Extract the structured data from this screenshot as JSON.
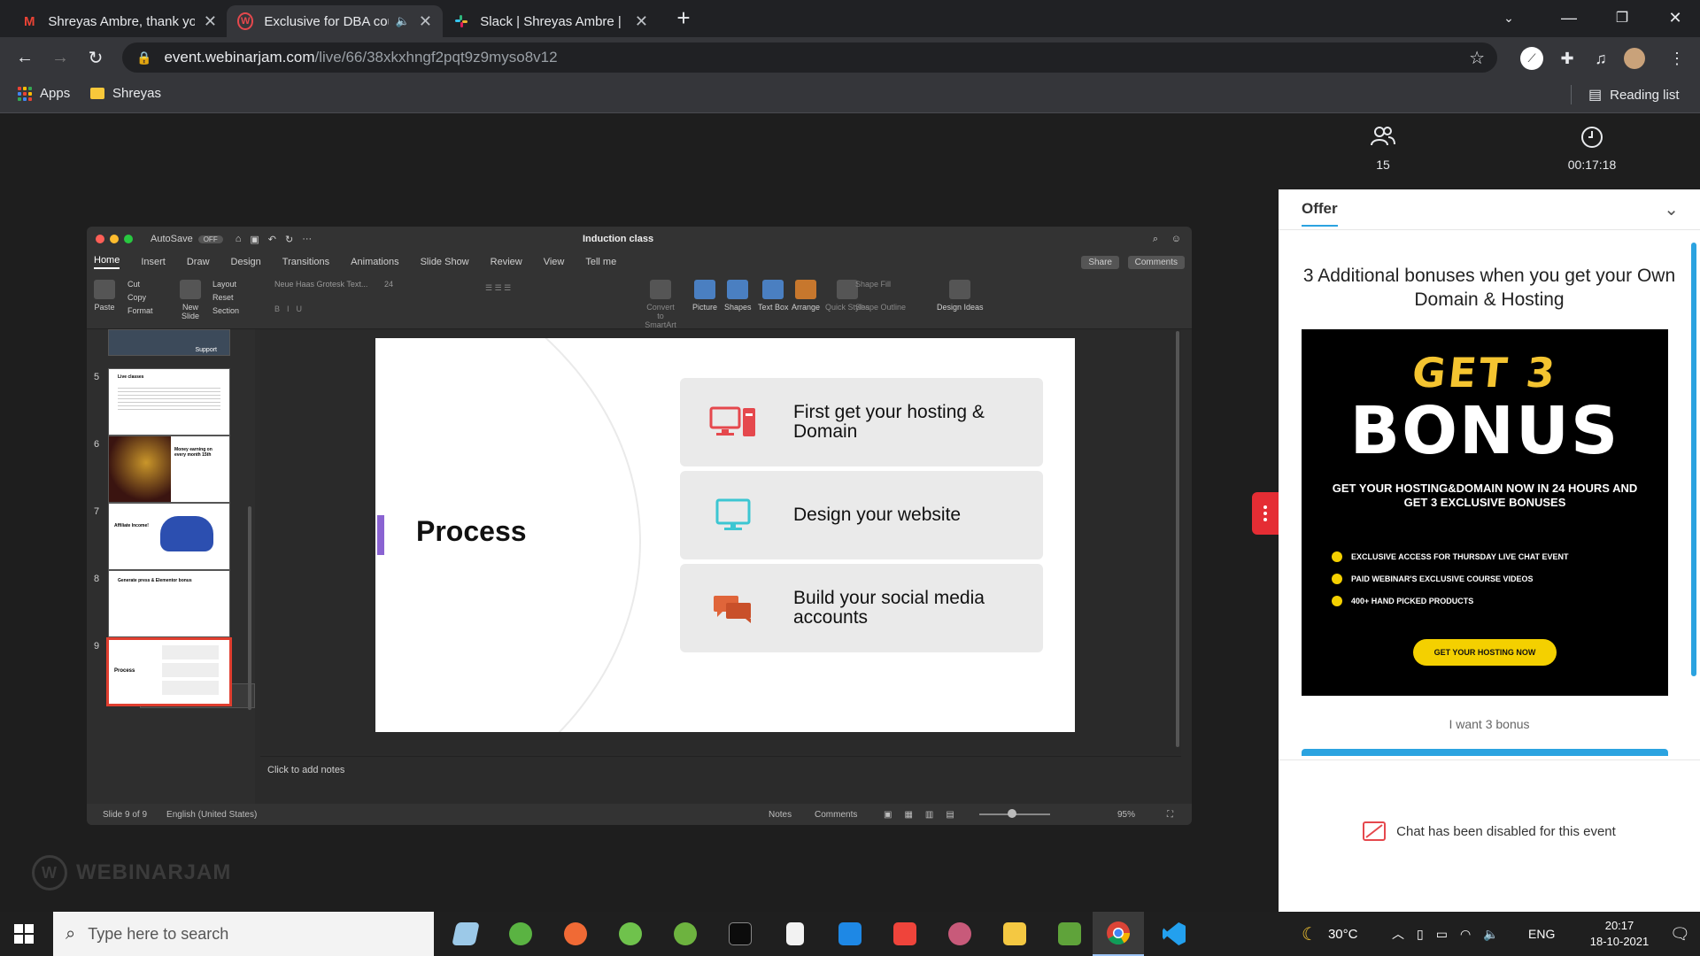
{
  "tabs": [
    {
      "title": "Shreyas Ambre, thank you for the",
      "icon": "gmail-icon",
      "active": false
    },
    {
      "title": "Exclusive for DBA course pur",
      "icon": "webinarjam-icon",
      "active": true
    },
    {
      "title": "Slack | Shreyas Ambre | Rupeese",
      "icon": "slack-icon",
      "active": false
    }
  ],
  "url": {
    "host": "event.webinarjam.com",
    "path": "/live/66/38xkxhngf2pqt9z9myso8v12"
  },
  "bookmarks": {
    "apps": "Apps",
    "folder": "Shreyas",
    "reading_list": "Reading list"
  },
  "ppt": {
    "autosave": "AutoSave",
    "autosave_state": "OFF",
    "doc_title": "Induction class",
    "menu": [
      "Home",
      "Insert",
      "Draw",
      "Design",
      "Transitions",
      "Animations",
      "Slide Show",
      "Review",
      "View",
      "Tell me"
    ],
    "share": "Share",
    "comments": "Comments",
    "ribbon": {
      "paste": "Paste",
      "cut": "Cut",
      "copy": "Copy",
      "format": "Format",
      "new_slide": "New Slide",
      "layout": "Layout",
      "reset": "Reset",
      "section": "Section",
      "font": "Neue Haas Grotesk Text...",
      "size": "24",
      "convert": "Convert to SmartArt",
      "picture": "Picture",
      "shapes": "Shapes",
      "textbox": "Text Box",
      "arrange": "Arrange",
      "quick_styles": "Quick Styles",
      "shape_fill": "Shape Fill",
      "shape_outline": "Shape Outline",
      "design_ideas": "Design Ideas"
    },
    "thumbs": [
      {
        "num": "5",
        "title": "Live classes"
      },
      {
        "num": "6",
        "title": "Money earning on every month 15th"
      },
      {
        "num": "7",
        "title": "Affiliate Income!"
      },
      {
        "num": "8",
        "title": "Generate press & Elementor bonus"
      },
      {
        "num": "9",
        "title": "Process"
      }
    ],
    "top_thumb_label": "Support",
    "tooltip": "Generate press & Elementor bonus",
    "slide": {
      "title": "Process",
      "cards": [
        "First get your hosting & Domain",
        "Design your website",
        "Build your social media accounts"
      ]
    },
    "notes_placeholder": "Click to add notes",
    "status": {
      "slide": "Slide 9 of 9",
      "lang": "English (United States)",
      "notes": "Notes",
      "comments": "Comments",
      "zoom": "95%"
    }
  },
  "webinar": {
    "brand": "WEBINARJAM",
    "attendees": "15",
    "timer": "00:17:18"
  },
  "offer": {
    "tab": "Offer",
    "title": "3 Additional bonuses when you get your Own Domain & Hosting",
    "banner": {
      "line1": "GET 3",
      "line2": "BONUS",
      "sub": "GET YOUR HOSTING&DOMAIN NOW IN 24 HOURS AND GET 3 EXCLUSIVE BONUSES",
      "items": [
        "EXCLUSIVE ACCESS FOR THURSDAY LIVE CHAT EVENT",
        "PAID WEBINAR'S EXCLUSIVE COURSE VIDEOS",
        "400+ HAND PICKED PRODUCTS"
      ],
      "button": "GET YOUR HOSTING NOW"
    },
    "want": "I want 3 bonus",
    "chat_disabled": "Chat has been disabled for this event"
  },
  "taskbar": {
    "search_placeholder": "Type here to search",
    "weather": "30°C",
    "lang": "ENG",
    "time": "20:17",
    "date": "18-10-2021"
  }
}
